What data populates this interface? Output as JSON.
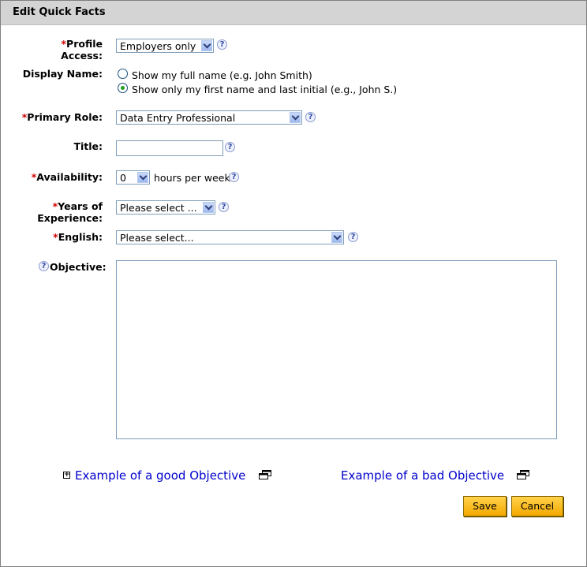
{
  "dialog": {
    "title": "Edit Quick Facts"
  },
  "form": {
    "required_mark": "*",
    "profile_access": {
      "label_line1": "Profile",
      "label_line2": "Access:",
      "value": "Employers only"
    },
    "display_name": {
      "label": "Display Name:",
      "options": [
        {
          "label": "Show my full name (e.g. John Smith)",
          "checked": false
        },
        {
          "label": "Show only my first name and last initial (e.g., John S.)",
          "checked": true
        }
      ]
    },
    "primary_role": {
      "label": "Primary Role:",
      "value": "Data Entry Professional"
    },
    "title": {
      "label": "Title:",
      "value": ""
    },
    "availability": {
      "label": "Availability:",
      "value": "0",
      "suffix": "hours per week"
    },
    "years_experience": {
      "label_line1": "Years of",
      "label_line2": "Experience:",
      "value": "Please select ..."
    },
    "english": {
      "label": "English:",
      "value": "Please select..."
    },
    "objective": {
      "label": "Objective:",
      "value": ""
    },
    "help_glyph": "?"
  },
  "links": {
    "good_objective": "Example of a good Objective",
    "bad_objective": "Example of a bad Objective",
    "expand_glyph": "+"
  },
  "buttons": {
    "save": "Save",
    "cancel": "Cancel"
  },
  "colors": {
    "title_bar": "#d4d4d4",
    "link": "#0000cc",
    "required": "#d00000",
    "button": "#f4a800"
  }
}
